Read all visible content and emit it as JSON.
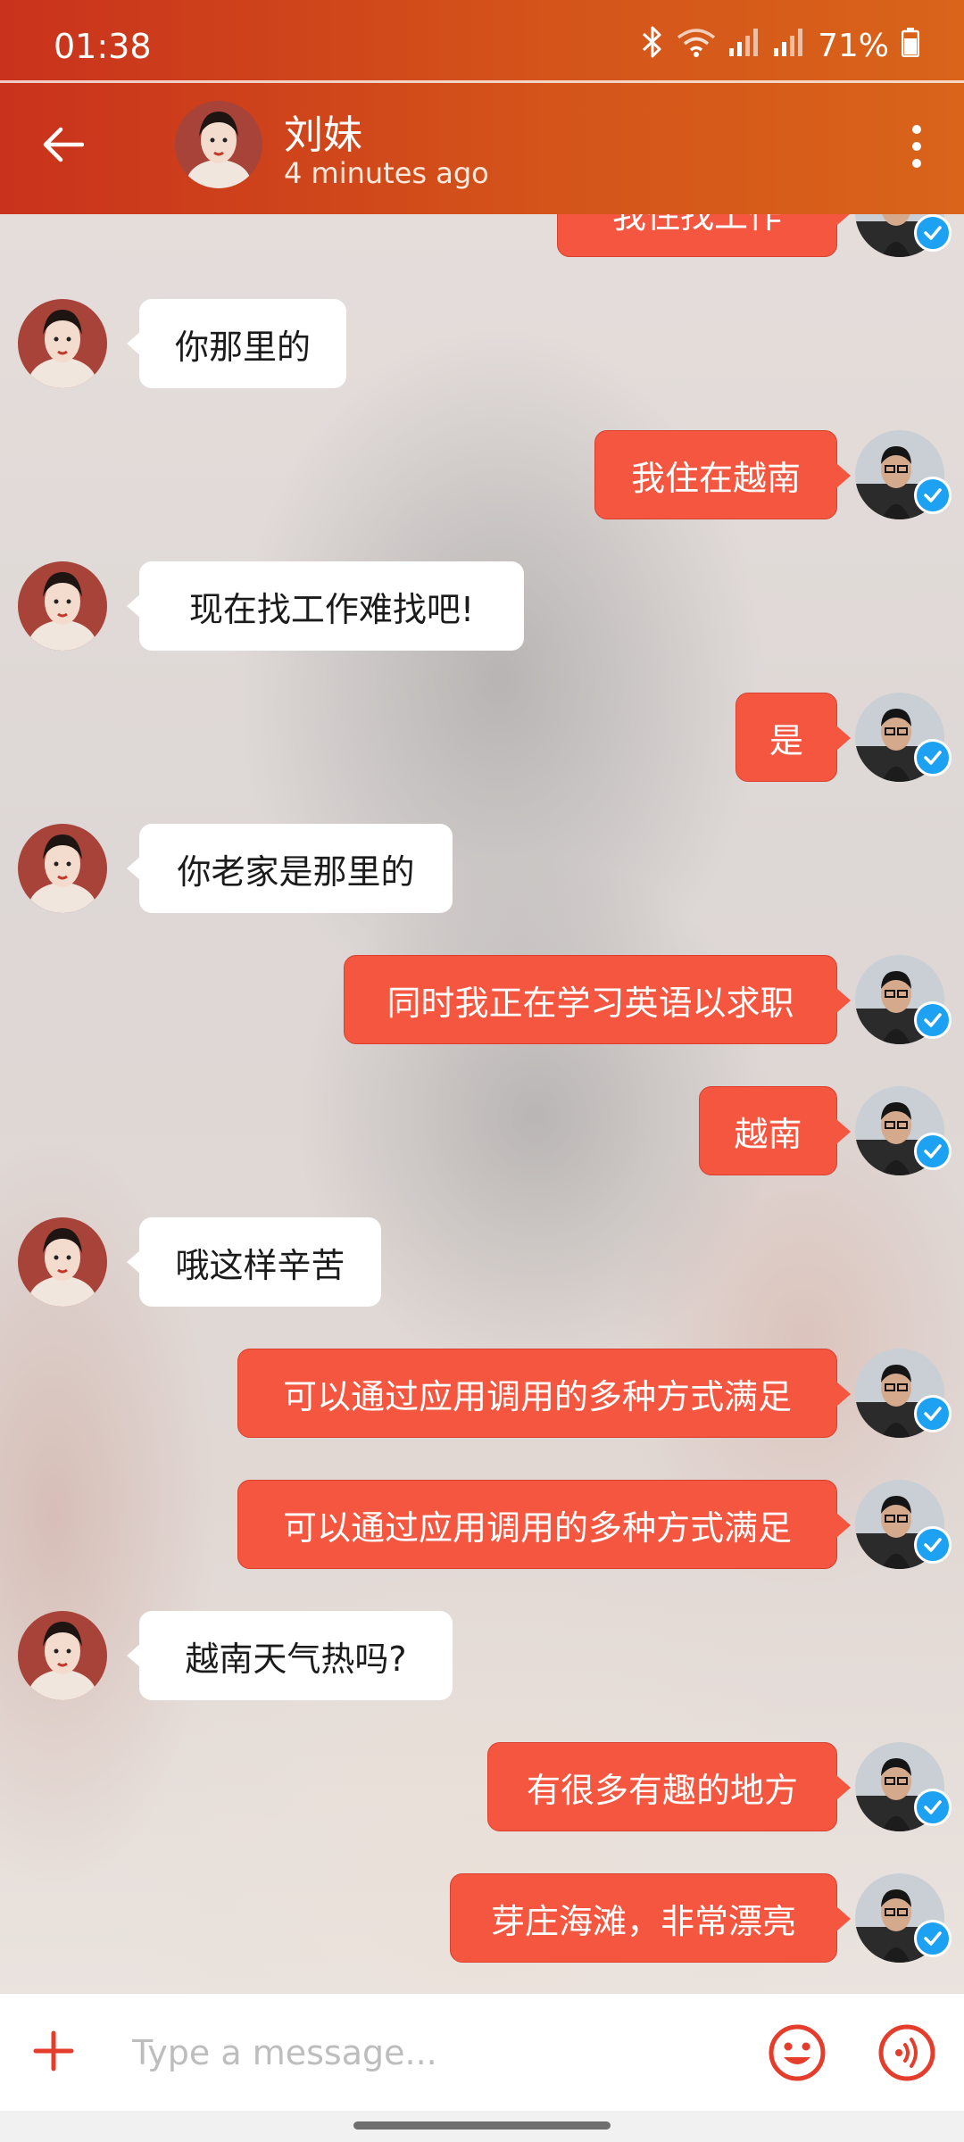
{
  "status_bar": {
    "time": "01:38",
    "battery": "71%"
  },
  "header": {
    "contact_name": "刘妹",
    "contact_status": "4 minutes ago"
  },
  "messages": [
    {
      "from": "me",
      "text": "我住找工作"
    },
    {
      "from": "contact",
      "text": "你那里的"
    },
    {
      "from": "me",
      "text": "我住在越南"
    },
    {
      "from": "contact",
      "text": "现在找工作难找吧!"
    },
    {
      "from": "me",
      "text": "是"
    },
    {
      "from": "contact",
      "text": "你老家是那里的"
    },
    {
      "from": "me",
      "text": "同时我正在学习英语以求职"
    },
    {
      "from": "me",
      "text": "越南"
    },
    {
      "from": "contact",
      "text": "哦这样辛苦"
    },
    {
      "from": "me",
      "text": "可以通过应用调用的多种方式满足"
    },
    {
      "from": "me",
      "text": "可以通过应用调用的多种方式满足"
    },
    {
      "from": "contact",
      "text": "越南天气热吗?"
    },
    {
      "from": "me",
      "text": "有很多有趣的地方"
    },
    {
      "from": "me",
      "text": "芽庄海滩，非常漂亮"
    }
  ],
  "composer": {
    "placeholder": "Type a message..."
  },
  "colors": {
    "header_start": "#c9321c",
    "header_end": "#d9641a",
    "outgoing_bubble": "#f45640",
    "incoming_bubble": "#ffffff",
    "accent": "#e53d2b",
    "verified_badge": "#1da1f2"
  },
  "icons": {
    "back": "arrow-left-icon",
    "more": "more-vertical-icon",
    "add": "plus-icon",
    "emoji": "smiley-icon",
    "voice": "voice-wave-icon",
    "verified": "check-badge-icon",
    "bluetooth": "bluetooth-icon",
    "wifi": "wifi-icon",
    "signal": "signal-icon",
    "battery": "battery-icon"
  }
}
